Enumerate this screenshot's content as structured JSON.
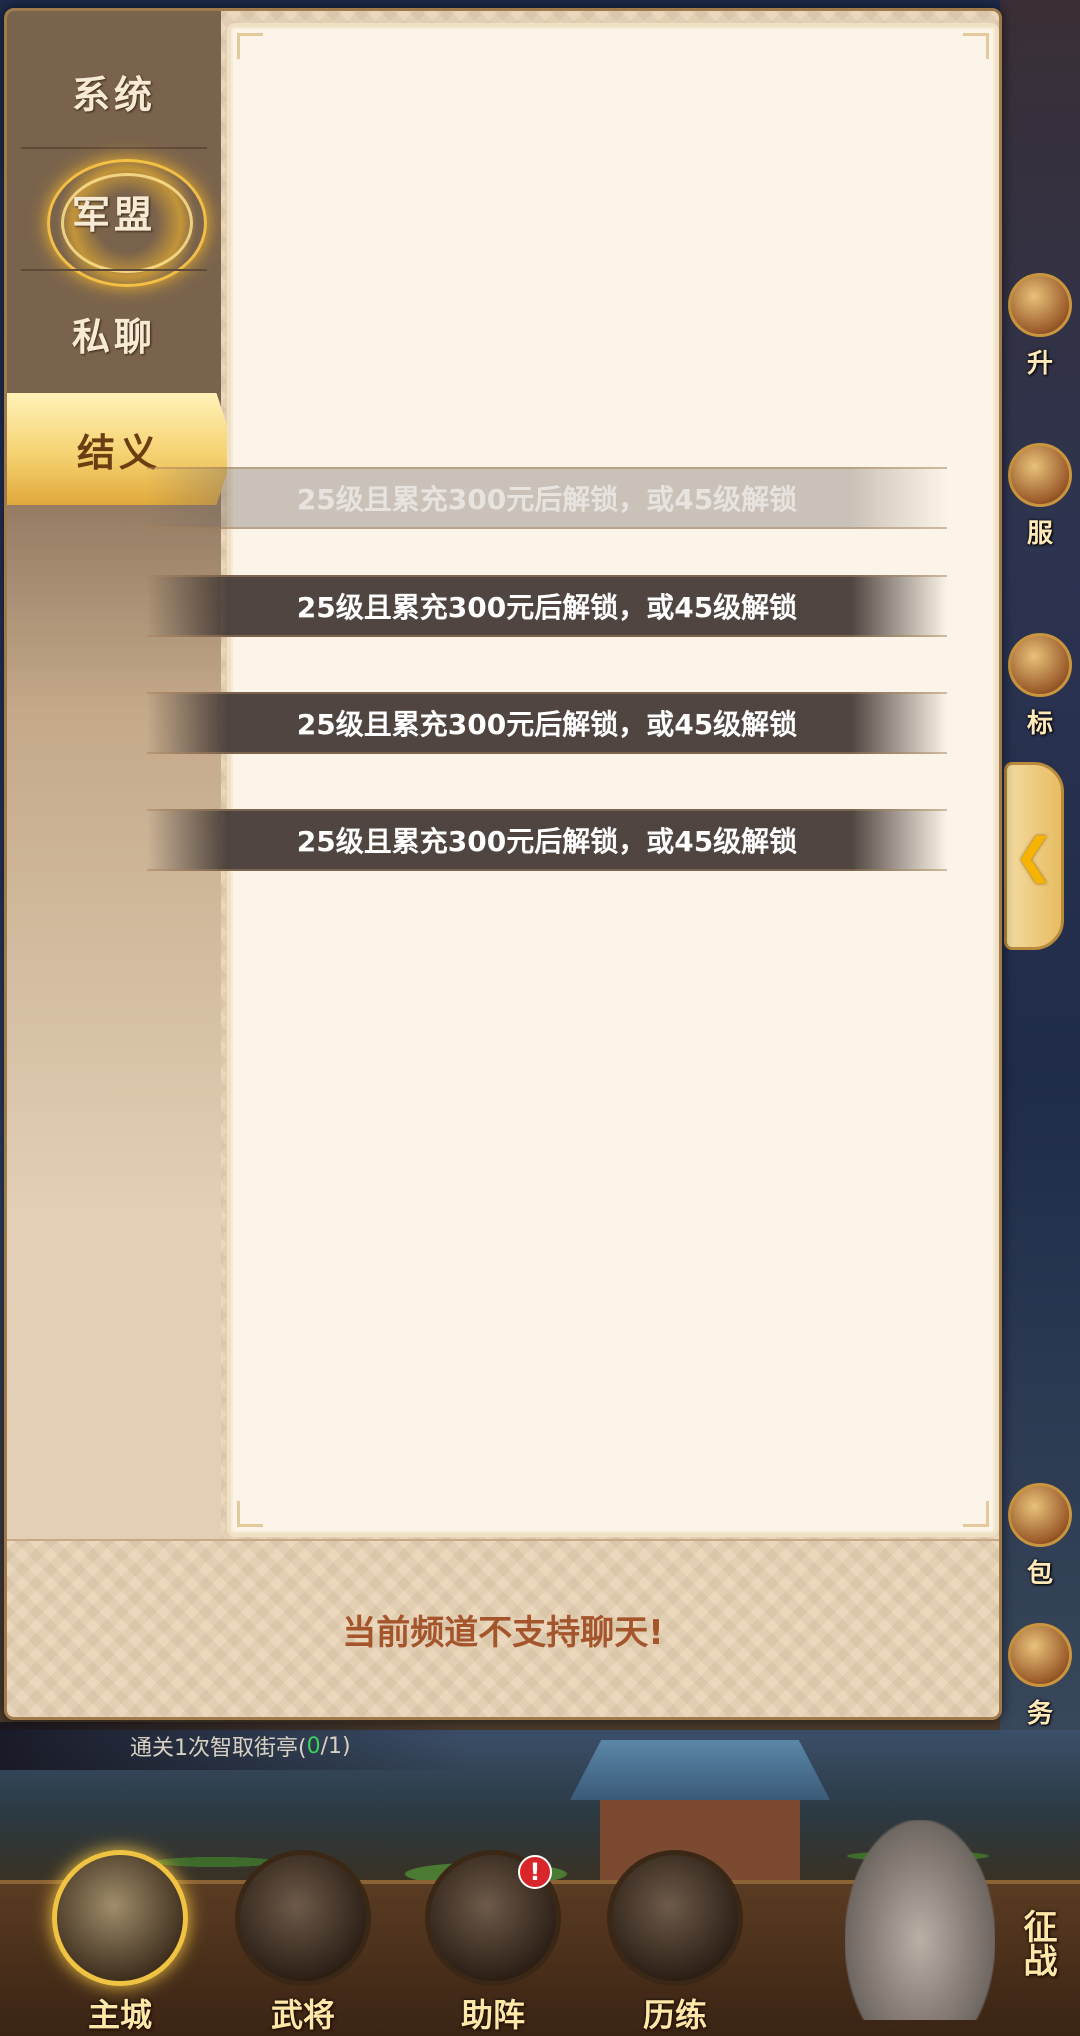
{
  "chat": {
    "channels": [
      {
        "id": "system",
        "label": "系统"
      },
      {
        "id": "legion",
        "label": "军盟"
      },
      {
        "id": "private",
        "label": "私聊"
      },
      {
        "id": "brotherhood",
        "label": "结义"
      }
    ],
    "active_channel": "结义",
    "unlock_messages": [
      "25级且累充300元后解锁，或45级解锁",
      "25级且累充300元后解锁，或45级解锁",
      "25级且累充300元后解锁，或45级解锁",
      "25级且累充300元后解锁，或45级解锁"
    ],
    "input_notice": "当前频道不支持聊天!",
    "collapse_icon": "chevron-left-icon"
  },
  "side_menu": {
    "labels": [
      "升",
      "服",
      "标",
      "包",
      "务"
    ]
  },
  "quest": {
    "text_prefix": "通关1次智取街亭(",
    "progress": "0",
    "text_suffix": "/1)"
  },
  "bottom_nav": {
    "items": [
      {
        "label": "主城",
        "active": true
      },
      {
        "label": "武将"
      },
      {
        "label": "助阵",
        "badge": "!"
      },
      {
        "label": "历练"
      }
    ],
    "conquer_label": "征战"
  },
  "colors": {
    "accent_gold": "#f6d271",
    "notice_text": "#a5552c",
    "badge_red": "#d9262a"
  }
}
